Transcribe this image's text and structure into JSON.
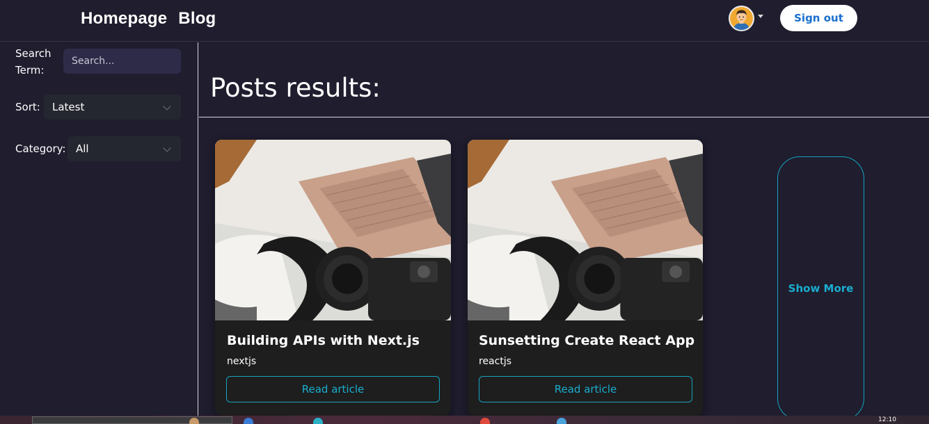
{
  "header": {
    "nav": [
      "Homepage",
      "Blog"
    ],
    "avatar_icon": "user-avatar-icon",
    "sign_out": "Sign out"
  },
  "sidebar": {
    "search_label": "Search Term:",
    "search_placeholder": "Search...",
    "sort_label": "Sort:",
    "sort_value": "Latest",
    "category_label": "Category:",
    "category_value": "All"
  },
  "main": {
    "title": "Posts results:",
    "posts": [
      {
        "title": "Building APIs with Next.js",
        "category": "nextjs",
        "button": "Read article"
      },
      {
        "title": "Sunsetting Create React App",
        "category": "reactjs",
        "button": "Read article"
      }
    ],
    "show_more": "Show More"
  },
  "taskbar": {
    "clock": "12:10"
  },
  "colors": {
    "background": "#1f1d2e",
    "accent": "#1aaed0",
    "signout_text": "#1a6fcf",
    "card_bg": "#1e1e1e"
  }
}
